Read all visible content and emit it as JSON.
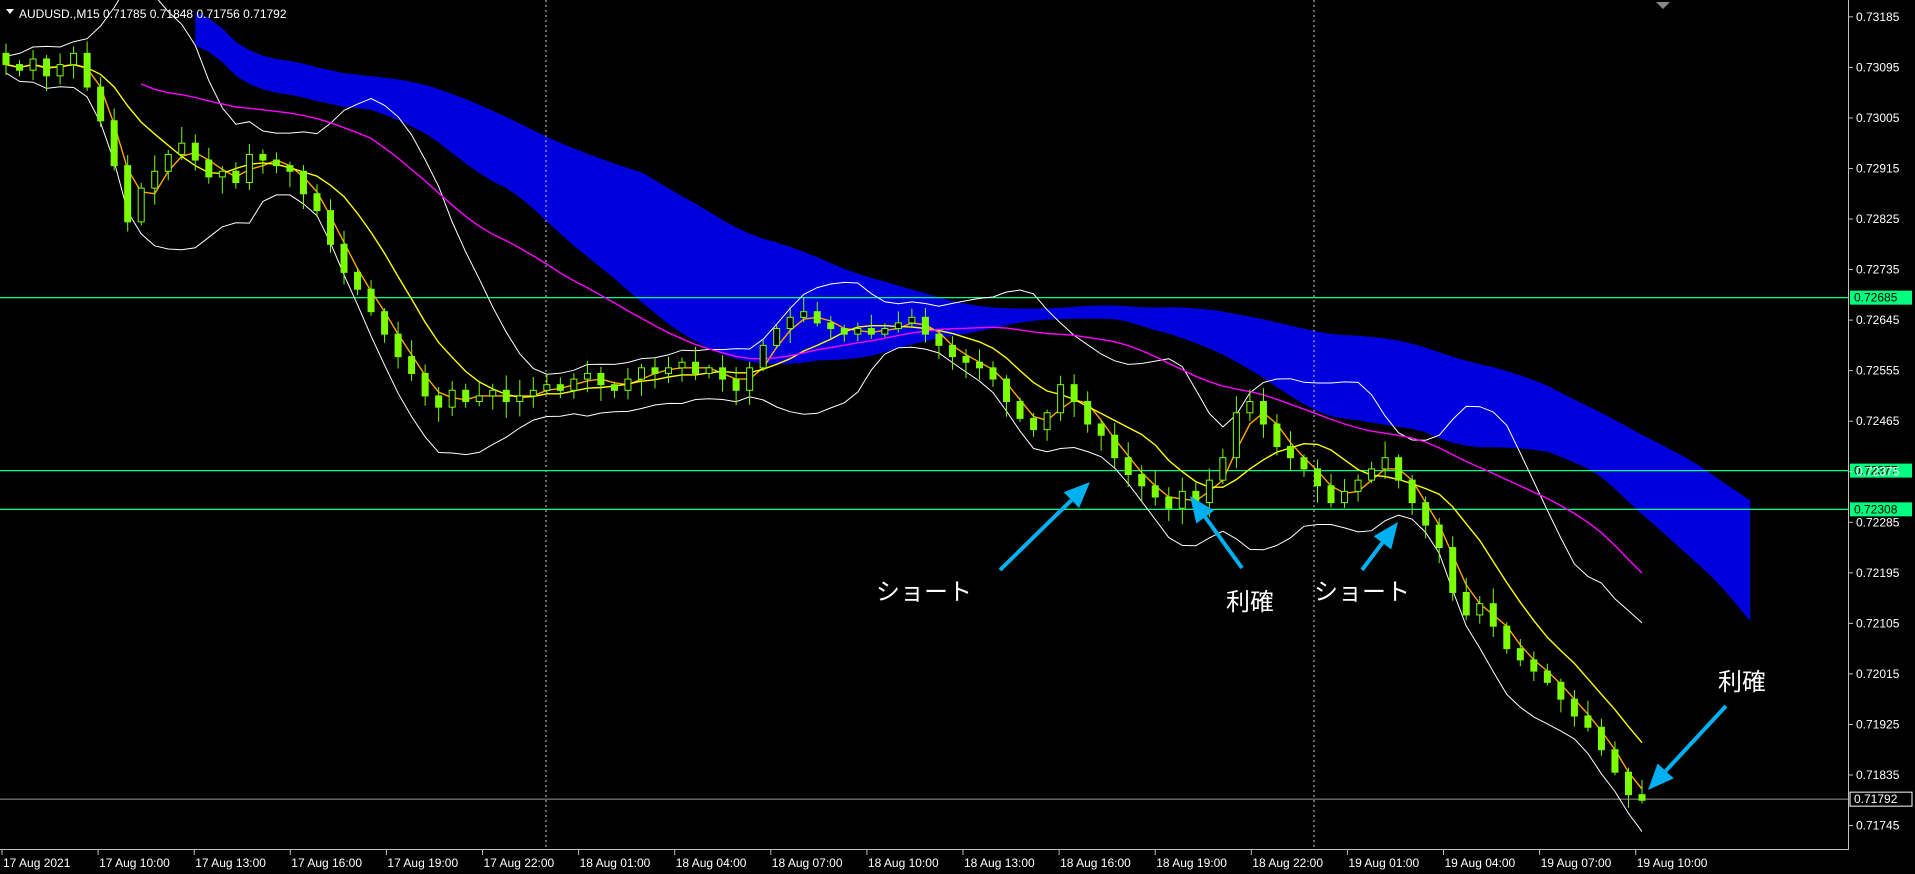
{
  "header": {
    "symbol_line": "AUDUSD.,M15  0.71785 0.71848 0.71756 0.71792"
  },
  "chart_data": {
    "type": "candlestick",
    "symbol": "AUDUSD.",
    "timeframe": "M15",
    "ohlc_header": {
      "open": 0.71785,
      "high": 0.71848,
      "low": 0.71756,
      "close": 0.71792
    },
    "ylim": [
      0.71705,
      0.73215
    ],
    "y_ticks": [
      "0.73185",
      "0.73095",
      "0.73005",
      "0.72915",
      "0.72825",
      "0.72735",
      "0.72645",
      "0.72555",
      "0.72465",
      "0.72375",
      "0.72285",
      "0.72195",
      "0.72105",
      "0.72015",
      "0.71925",
      "0.71835",
      "0.71745"
    ],
    "x_ticks": [
      "17 Aug 2021",
      "17 Aug 10:00",
      "17 Aug 13:00",
      "17 Aug 16:00",
      "17 Aug 19:00",
      "17 Aug 22:00",
      "18 Aug 01:00",
      "18 Aug 04:00",
      "18 Aug 07:00",
      "18 Aug 10:00",
      "18 Aug 13:00",
      "18 Aug 16:00",
      "18 Aug 19:00",
      "18 Aug 22:00",
      "19 Aug 01:00",
      "19 Aug 04:00",
      "19 Aug 07:00",
      "19 Aug 10:00"
    ],
    "horizontal_levels": [
      {
        "value": 0.72685,
        "label": "0.72685"
      },
      {
        "value": 0.72377,
        "label": "0.72377"
      },
      {
        "value": 0.72308,
        "label": "0.72308"
      }
    ],
    "current_price": {
      "value": 0.71792,
      "label": "0.71792"
    },
    "period_separators": [
      "18 Aug 2021",
      "19 Aug 2021"
    ],
    "closes": [
      0.731,
      0.7309,
      0.7311,
      0.7308,
      0.731,
      0.7312,
      0.7306,
      0.73,
      0.7292,
      0.7282,
      0.7288,
      0.7291,
      0.7294,
      0.7296,
      0.7293,
      0.729,
      0.7291,
      0.7289,
      0.7294,
      0.7293,
      0.7292,
      0.7291,
      0.7287,
      0.7284,
      0.7278,
      0.7273,
      0.727,
      0.7266,
      0.7262,
      0.7258,
      0.7255,
      0.7251,
      0.7249,
      0.7252,
      0.725,
      0.7251,
      0.7252,
      0.725,
      0.7251,
      0.7252,
      0.7253,
      0.7252,
      0.7254,
      0.7255,
      0.7253,
      0.7252,
      0.7254,
      0.7256,
      0.7255,
      0.7256,
      0.7257,
      0.7255,
      0.7256,
      0.7254,
      0.7252,
      0.7256,
      0.726,
      0.7263,
      0.7265,
      0.7266,
      0.7264,
      0.7263,
      0.7262,
      0.7263,
      0.7262,
      0.7263,
      0.7264,
      0.7265,
      0.7262,
      0.726,
      0.7258,
      0.7257,
      0.7256,
      0.7254,
      0.725,
      0.7247,
      0.7245,
      0.7248,
      0.7253,
      0.725,
      0.7246,
      0.7244,
      0.724,
      0.7237,
      0.7235,
      0.7233,
      0.7231,
      0.7234,
      0.7232,
      0.7236,
      0.724,
      0.7248,
      0.725,
      0.7246,
      0.7242,
      0.724,
      0.7238,
      0.7235,
      0.7232,
      0.7234,
      0.7236,
      0.7238,
      0.724,
      0.7236,
      0.7232,
      0.7228,
      0.7224,
      0.7216,
      0.7212,
      0.7214,
      0.721,
      0.7206,
      0.7204,
      0.7202,
      0.72,
      0.7197,
      0.7194,
      0.7192,
      0.7188,
      0.7184,
      0.718,
      0.7179
    ],
    "annotations": [
      {
        "text": "ショート"
      },
      {
        "text": "利確"
      },
      {
        "text": "ショート"
      },
      {
        "text": "利確"
      }
    ],
    "colors": {
      "background": "#000000",
      "candle": "#7CFC00",
      "ichimoku_cloud": "#0000DD",
      "ma_fast": "#FFA500",
      "ma_slow": "#FFFF00",
      "ma_long": "#FF00FF",
      "bollinger": "#FFFFFF",
      "levels": "#00FF7F",
      "arrows": "#00B0F0"
    }
  }
}
